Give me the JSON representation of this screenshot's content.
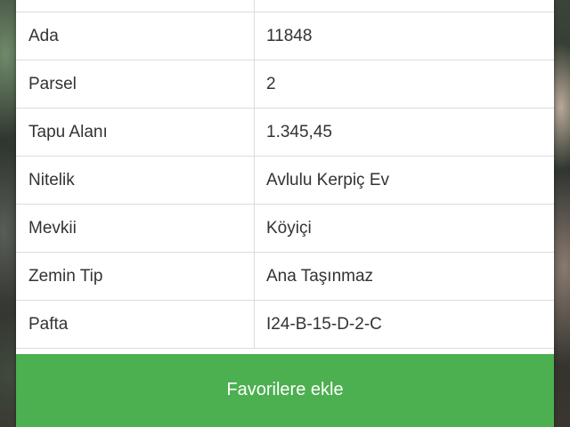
{
  "details": {
    "rows": [
      {
        "label": "",
        "value": ""
      },
      {
        "label": "Ada",
        "value": "11848"
      },
      {
        "label": "Parsel",
        "value": "2"
      },
      {
        "label": "Tapu Alanı",
        "value": "1.345,45"
      },
      {
        "label": "Nitelik",
        "value": "Avlulu Kerpiç Ev"
      },
      {
        "label": "Mevkii",
        "value": "Köyiçi"
      },
      {
        "label": "Zemin Tip",
        "value": "Ana Taşınmaz"
      },
      {
        "label": "Pafta",
        "value": "I24-B-15-D-2-C"
      }
    ]
  },
  "actions": {
    "favorite_label": "Favorilere ekle"
  },
  "colors": {
    "accent_green": "#4caf50",
    "divider": "#dcdcdc",
    "text": "#333333"
  }
}
